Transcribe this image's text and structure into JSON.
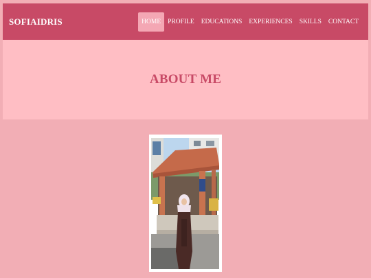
{
  "brand": "SOFIAIDRIS",
  "nav": {
    "items": [
      "HOME",
      "PROFILE",
      "EDUCATIONS",
      "EXPERIENCES",
      "SKILLS",
      "CONTACT"
    ],
    "active": "HOME"
  },
  "hero": {
    "title": "ABOUT ME"
  },
  "colors": {
    "navbar": "#c84a66",
    "hero_bg": "#ffbec4",
    "page_bg": "#f2aeb5",
    "active_tab": "#f4a7b4"
  }
}
